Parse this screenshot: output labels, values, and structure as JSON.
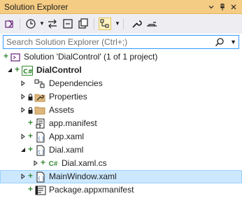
{
  "titlebar": {
    "title": "Solution Explorer",
    "dropdown_icon": "chevron-down-icon",
    "pin_icon": "pin-icon",
    "close_icon": "close-icon"
  },
  "toolbar": {
    "buttons": [
      {
        "name": "switch-views",
        "icon": "vs-switch-views-icon"
      },
      {
        "name": "pending-changes-filter",
        "icon": "clock-icon"
      },
      {
        "name": "sync-with-active-document",
        "icon": "sync-icon"
      },
      {
        "name": "collapse-all",
        "icon": "collapse-all-icon"
      },
      {
        "name": "show-all-files",
        "icon": "show-all-files-icon"
      },
      {
        "name": "show-files-in-tree",
        "icon": "tree-view-icon",
        "active": true
      },
      {
        "name": "properties",
        "icon": "wrench-icon"
      },
      {
        "name": "preview-selected-items",
        "icon": "preview-icon"
      }
    ]
  },
  "search": {
    "placeholder": "Search Solution Explorer (Ctrl+;)",
    "value": ""
  },
  "tree": [
    {
      "label": "Solution 'DialControl' (1 of 1 project)",
      "icon": "solution-icon",
      "bold": false
    },
    {
      "label": "DialControl",
      "icon": "csharp-project-icon",
      "bold": true
    },
    {
      "label": "Dependencies",
      "icon": "dependencies-icon"
    },
    {
      "label": "Properties",
      "icon": "wrench-folder-icon"
    },
    {
      "label": "Assets",
      "icon": "folder-icon"
    },
    {
      "label": "app.manifest",
      "icon": "manifest-icon"
    },
    {
      "label": "App.xaml",
      "icon": "xaml-icon"
    },
    {
      "label": "Dial.xaml",
      "icon": "xaml-icon"
    },
    {
      "label": "Dial.xaml.cs",
      "icon": "csharp-file-icon"
    },
    {
      "label": "MainWindow.xaml",
      "icon": "xaml-icon",
      "selected": true
    },
    {
      "label": "Package.appxmanifest",
      "icon": "appxmanifest-icon"
    }
  ],
  "csharp_badge": "C#",
  "colors": {
    "titlebar_bg": "#f5cc84",
    "toolbar_bg": "#eeeef2",
    "selection_bg": "#cce8ff",
    "selection_border": "#99d1ff",
    "git_add_green": "#388a34",
    "search_border": "#3399ff"
  }
}
